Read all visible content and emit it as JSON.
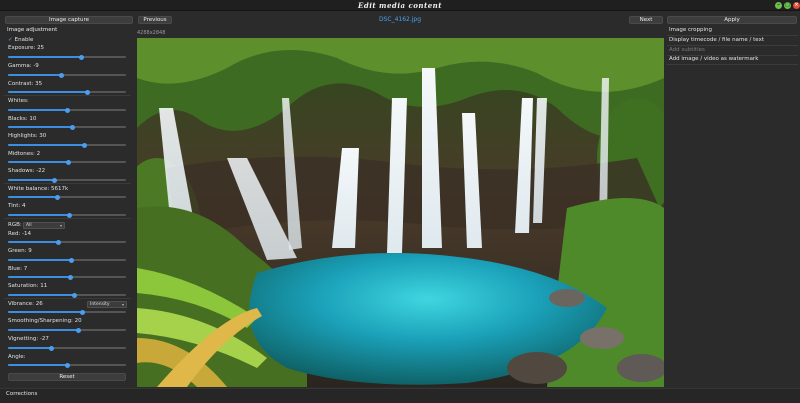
{
  "window": {
    "title": "Edit media content"
  },
  "toolbar": {
    "image_capture": "Image capture",
    "previous": "Previous",
    "filename": "DSC_4162.jpg",
    "next": "Next",
    "apply": "Apply"
  },
  "image": {
    "dimensions": "4288x2848"
  },
  "adjust": {
    "section_title": "Image adjustment",
    "enable": "Enable",
    "exposure": "Exposure: 25",
    "gamma": "Gamma: -9",
    "contrast": "Contrast: 35",
    "whites": "Whites:",
    "blacks": "Blacks: 10",
    "highlights": "Highlights: 30",
    "midtones": "Midtones: 2",
    "shadows": "Shadows: -22",
    "white_balance": "White balance: 5617k",
    "tint": "Tint: 4",
    "rgb": "RGB:",
    "rgb_select": "All",
    "red": "Red: -14",
    "green": "Green: 9",
    "blue": "Blue: 7",
    "saturation": "Saturation: 11",
    "vibrance": "Vibrance: 26",
    "vibrance_select": "Intensity",
    "smoothing": "Smoothing/Sharpening: 20",
    "vignetting": "Vignetting: -27",
    "angle": "Angle:",
    "reset": "Reset",
    "levels": {
      "exposure": 0.62,
      "gamma": 0.45,
      "contrast": 0.67,
      "whites": 0.5,
      "blacks": 0.55,
      "highlights": 0.65,
      "midtones": 0.51,
      "shadows": 0.39,
      "white_balance": 0.42,
      "tint": 0.52,
      "red": 0.43,
      "green": 0.54,
      "blue": 0.53,
      "saturation": 0.56,
      "vibrance": 0.63,
      "smoothing": 0.6,
      "vignetting": 0.37,
      "angle": 0.5
    }
  },
  "right": {
    "image_cropping": "Image cropping",
    "display_timecode": "Display timecode / file name / text",
    "add_subtitles": "Add subtitles",
    "add_watermark": "Add image / video as watermark"
  },
  "bottom": {
    "corrections": "Corrections"
  },
  "colors": {
    "accent": "#3d8ee0",
    "filename": "#4aa3f0",
    "background": "#2b2b2b"
  }
}
